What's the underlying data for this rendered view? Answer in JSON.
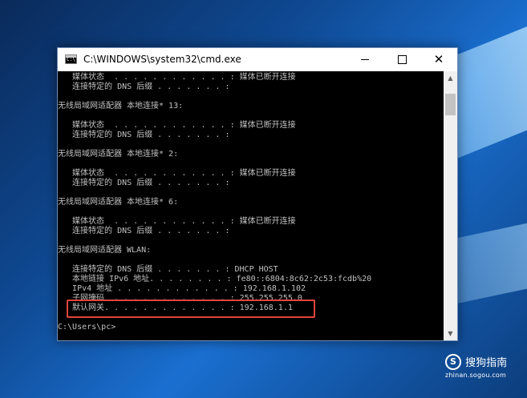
{
  "window": {
    "title": "C:\\WINDOWS\\system32\\cmd.exe",
    "controls": {
      "minimize": "—",
      "maximize": "□",
      "close": "✕"
    }
  },
  "console": {
    "lines": [
      "   媒体状态  . . . . . . . . . . . . : 媒体已断开连接",
      "   连接特定的 DNS 后缀 . . . . . . . :",
      "",
      "无线局域网适配器 本地连接* 13:",
      "",
      "   媒体状态  . . . . . . . . . . . . : 媒体已断开连接",
      "   连接特定的 DNS 后缀 . . . . . . . :",
      "",
      "无线局域网适配器 本地连接* 2:",
      "",
      "   媒体状态  . . . . . . . . . . . . : 媒体已断开连接",
      "   连接特定的 DNS 后缀 . . . . . . . :",
      "",
      "无线局域网适配器 本地连接* 6:",
      "",
      "   媒体状态  . . . . . . . . . . . . : 媒体已断开连接",
      "   连接特定的 DNS 后缀 . . . . . . . :",
      "",
      "无线局域网适配器 WLAN:",
      "",
      "   连接特定的 DNS 后缀 . . . . . . . : DHCP HOST",
      "   本地链接 IPv6 地址. . . . . . . . : fe80::6804:8c62:2c53:fcdb%20",
      "   IPv4 地址 . . . . . . . . . . . . : 192.168.1.102",
      "   子网掩码  . . . . . . . . . . . . : 255.255.255.0",
      "   默认网关. . . . . . . . . . . . . : 192.168.1.1",
      "",
      "C:\\Users\\pc>"
    ]
  },
  "scrollbar": {
    "up_arrow": "▲",
    "down_arrow": "▼"
  },
  "watermark": {
    "logo": "S",
    "brand": "搜狗指南",
    "url": "zhinan.sogou.com"
  }
}
